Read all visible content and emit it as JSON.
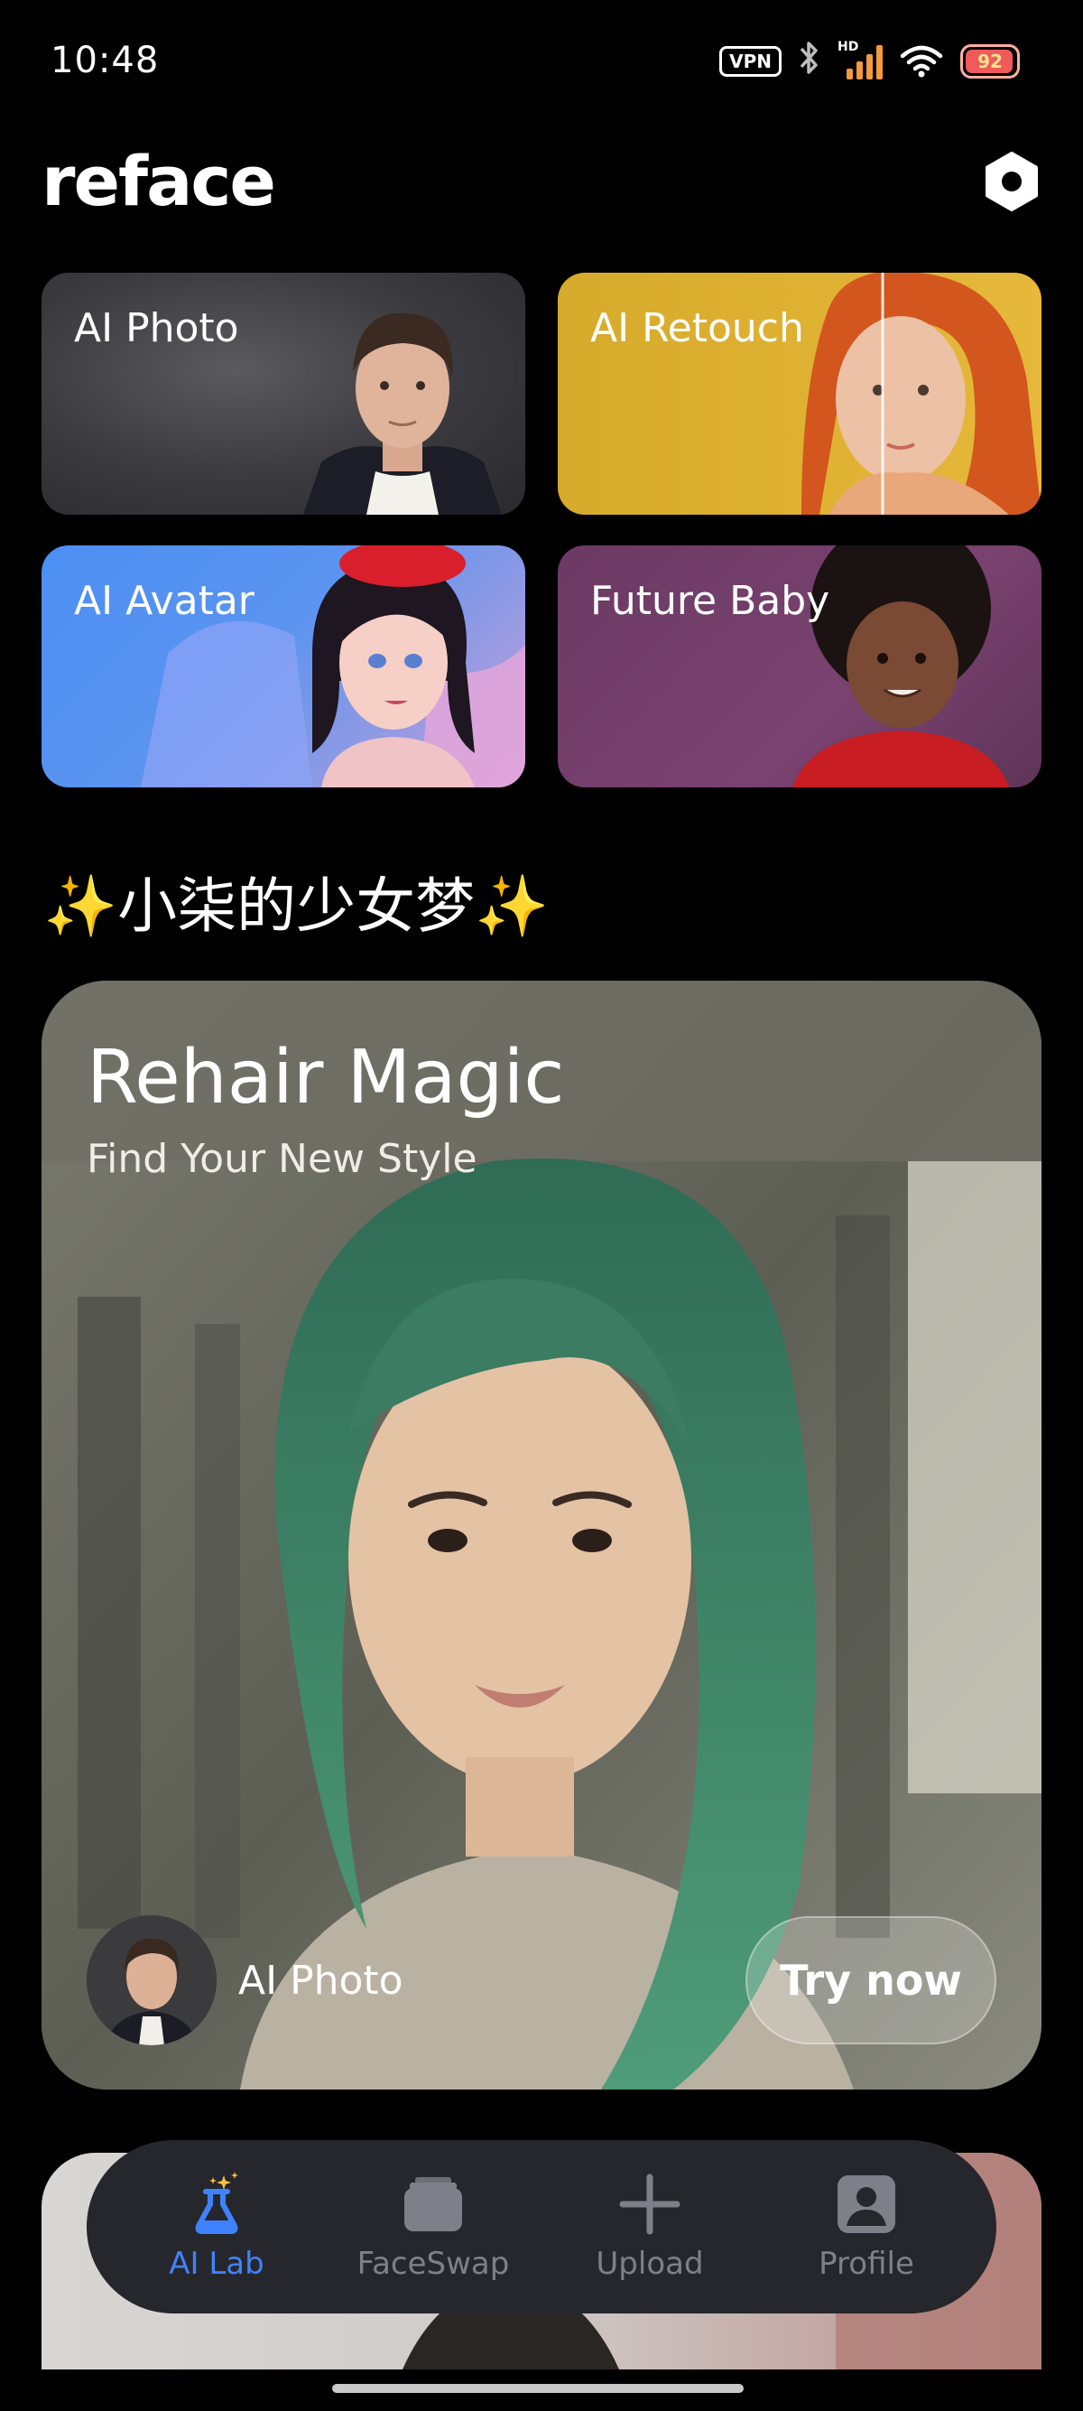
{
  "status_bar": {
    "time": "10:48",
    "vpn": "VPN",
    "signal_label": "HD",
    "battery": "92",
    "icons": [
      "vpn-icon",
      "bluetooth-icon",
      "signal-icon",
      "wifi-icon",
      "battery-icon"
    ]
  },
  "header": {
    "logo": "reface",
    "settings_icon": "gear-icon"
  },
  "features": [
    {
      "label": "AI Photo"
    },
    {
      "label": "AI Retouch"
    },
    {
      "label": "AI Avatar"
    },
    {
      "label": "Future Baby"
    }
  ],
  "section": {
    "title": "✨小柒的少女梦✨"
  },
  "hero": {
    "title": "Rehair Magic",
    "subtitle": "Find Your New Style",
    "avatar_label": "AI Photo",
    "cta": "Try now"
  },
  "bottom_nav": {
    "items": [
      {
        "label": "AI Lab",
        "icon": "flask-icon",
        "active": true
      },
      {
        "label": "FaceSwap",
        "icon": "cards-icon",
        "active": false
      },
      {
        "label": "Upload",
        "icon": "plus-icon",
        "active": false
      },
      {
        "label": "Profile",
        "icon": "person-icon",
        "active": false
      }
    ]
  },
  "colors": {
    "background": "#000000",
    "accent": "#3f82ff",
    "nav_bg": "#26272c",
    "nav_inactive": "#7e8089"
  }
}
